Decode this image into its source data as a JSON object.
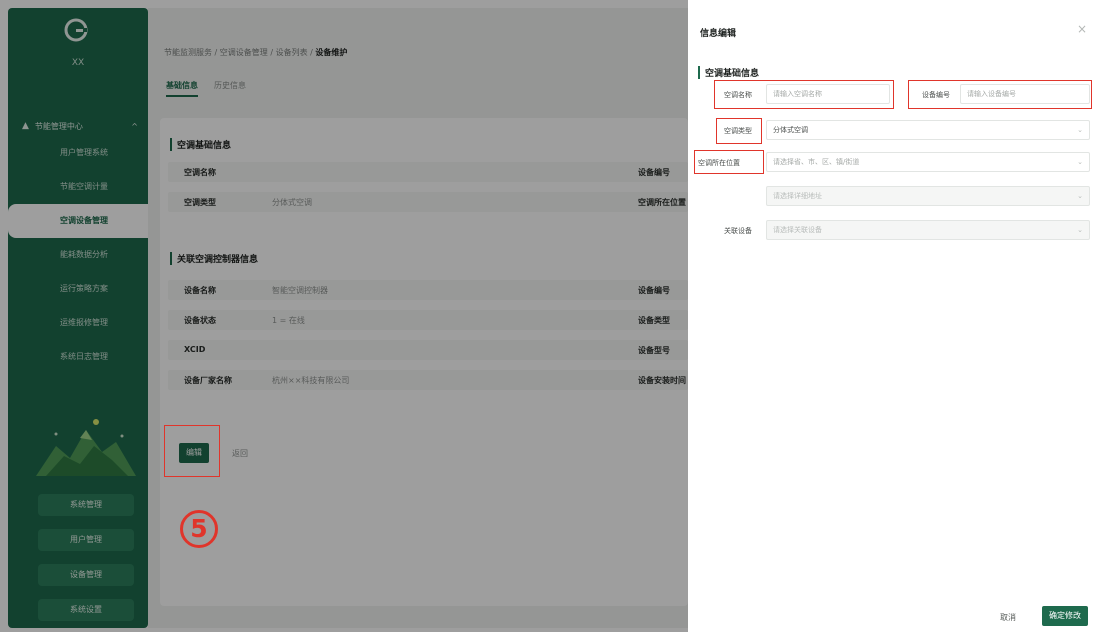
{
  "sidebar": {
    "logo_text": "XX",
    "group_label": "节能管理中心",
    "items": [
      {
        "label": "用户管理系统"
      },
      {
        "label": "节能空调计量"
      },
      {
        "label": "空调设备管理"
      },
      {
        "label": "能耗数据分析"
      },
      {
        "label": "运行策略方案"
      },
      {
        "label": "运维报修管理"
      },
      {
        "label": "系统日志管理"
      }
    ],
    "footer_buttons": [
      {
        "label": "系统管理"
      },
      {
        "label": "用户管理"
      },
      {
        "label": "设备管理"
      },
      {
        "label": "系统设置"
      }
    ]
  },
  "main": {
    "breadcrumb": {
      "part1": "节能监测服务",
      "part2": "空调设备管理",
      "part3": "设备列表",
      "current": "设备维护",
      "separator": "/"
    },
    "tabs": [
      {
        "label": "基础信息"
      },
      {
        "label": "历史信息"
      }
    ],
    "section1": {
      "title": "空调基础信息",
      "rows": [
        {
          "label": "空调名称",
          "value": "",
          "label2": "设备编号"
        },
        {
          "label": "空调类型",
          "value": "分体式空调",
          "label2": "空调所在位置"
        }
      ]
    },
    "section2": {
      "title": "关联空调控制器信息",
      "rows": [
        {
          "label": "设备名称",
          "value": "智能空调控制器",
          "label2": "设备编号"
        },
        {
          "label": "设备状态",
          "value": "1 = 在线",
          "label2": "设备类型"
        },
        {
          "label": "XCID",
          "value": "",
          "label2": "设备型号"
        },
        {
          "label": "设备厂家名称",
          "value": "杭州××科技有限公司",
          "label2": "设备安装时间"
        }
      ]
    },
    "edit_label": "编辑",
    "back_label": "返回",
    "step_number": "5"
  },
  "drawer": {
    "title": "信息编辑",
    "close_icon": "×",
    "section_title": "空调基础信息",
    "fields": {
      "name": {
        "label": "空调名称",
        "placeholder": "请输入空调名称"
      },
      "number": {
        "label": "设备编号",
        "placeholder": "请输入设备编号"
      },
      "type": {
        "label": "空调类型",
        "value": "分体式空调"
      },
      "location": {
        "label": "空调所在位置",
        "placeholder": "请选择省、市、区、镇/街道"
      },
      "location_detail": {
        "placeholder": "请选择详细地址"
      },
      "device": {
        "label": "关联设备",
        "placeholder": "请选择关联设备"
      }
    },
    "cancel_label": "取消",
    "confirm_label": "确定修改"
  },
  "colors": {
    "brand_green": "#1e6a4d",
    "highlight_red": "#e0352b"
  }
}
